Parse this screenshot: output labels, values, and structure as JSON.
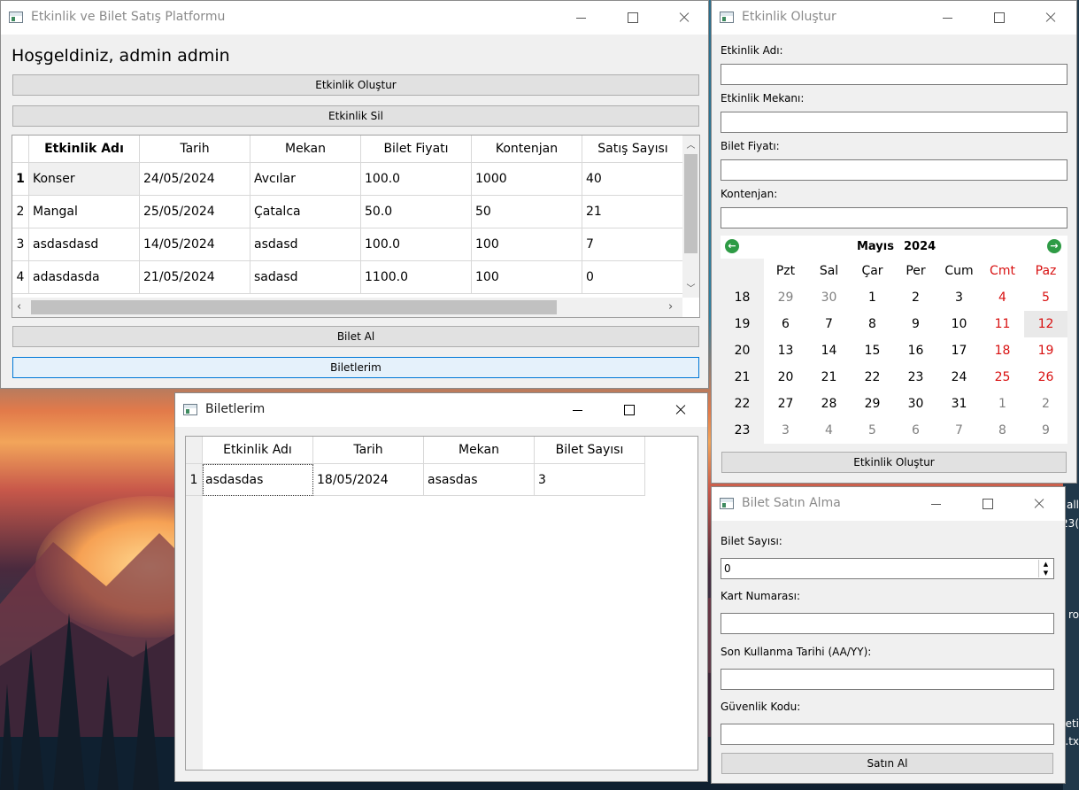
{
  "desktop": {
    "edge_text_1": "all",
    "edge_text_2": "23(",
    "edge_text_3": "ro",
    "edge_text_4": "eti",
    "edge_text_5": ".tx"
  },
  "main_window": {
    "title": "Etkinlik ve Bilet Satış Platformu",
    "welcome": "Hoşgeldiniz, admin admin",
    "btn_create": "Etkinlik Oluştur",
    "btn_delete": "Etkinlik Sil",
    "btn_buy": "Bilet Al",
    "btn_tickets": "Biletlerim",
    "table": {
      "headers": [
        "Etkinlik Adı",
        "Tarih",
        "Mekan",
        "Bilet Fiyatı",
        "Kontenjan",
        "Satış Sayısı"
      ],
      "rows": [
        {
          "n": "1",
          "c": [
            "Konser",
            "24/05/2024",
            "Avcılar",
            "100.0",
            "1000",
            "40"
          ]
        },
        {
          "n": "2",
          "c": [
            "Mangal",
            "25/05/2024",
            "Çatalca",
            "50.0",
            "50",
            "21"
          ]
        },
        {
          "n": "3",
          "c": [
            "asdasdasd",
            "14/05/2024",
            "asdasd",
            "100.0",
            "100",
            "7"
          ]
        },
        {
          "n": "4",
          "c": [
            "adasdasda",
            "21/05/2024",
            "sadasd",
            "1100.0",
            "100",
            "0"
          ]
        }
      ]
    }
  },
  "tickets_window": {
    "title": "Biletlerim",
    "table": {
      "headers": [
        "Etkinlik Adı",
        "Tarih",
        "Mekan",
        "Bilet Sayısı"
      ],
      "rows": [
        {
          "n": "1",
          "c": [
            "asdasdas",
            "18/05/2024",
            "asasdas",
            "3"
          ]
        }
      ]
    }
  },
  "create_window": {
    "title": "Etkinlik Oluştur",
    "label_name": "Etkinlik Adı:",
    "label_venue": "Etkinlik Mekanı:",
    "label_price": "Bilet Fiyatı:",
    "label_capacity": "Kontenjan:",
    "calendar": {
      "month": "Mayıs",
      "year": "2024",
      "weekdays": [
        "Pzt",
        "Sal",
        "Çar",
        "Per",
        "Cum",
        "Cmt",
        "Paz"
      ],
      "weeks": [
        {
          "w": "18",
          "d": [
            "29",
            "30",
            "1",
            "2",
            "3",
            "4",
            "5"
          ]
        },
        {
          "w": "19",
          "d": [
            "6",
            "7",
            "8",
            "9",
            "10",
            "11",
            "12"
          ]
        },
        {
          "w": "20",
          "d": [
            "13",
            "14",
            "15",
            "16",
            "17",
            "18",
            "19"
          ]
        },
        {
          "w": "21",
          "d": [
            "20",
            "21",
            "22",
            "23",
            "24",
            "25",
            "26"
          ]
        },
        {
          "w": "22",
          "d": [
            "27",
            "28",
            "29",
            "30",
            "31",
            "1",
            "2"
          ]
        },
        {
          "w": "23",
          "d": [
            "3",
            "4",
            "5",
            "6",
            "7",
            "8",
            "9"
          ]
        }
      ],
      "selected_day": "12",
      "weekend_color": "#d81010",
      "nav_color": "#2e9b45"
    },
    "btn_create": "Etkinlik Oluştur"
  },
  "purchase_window": {
    "title": "Bilet Satın Alma",
    "label_count": "Bilet Sayısı:",
    "count_value": "0",
    "label_card": "Kart Numarası:",
    "label_expiry": "Son Kullanma Tarihi (AA/YY):",
    "label_cvv": "Güvenlik Kodu:",
    "btn_buy": "Satın Al"
  }
}
